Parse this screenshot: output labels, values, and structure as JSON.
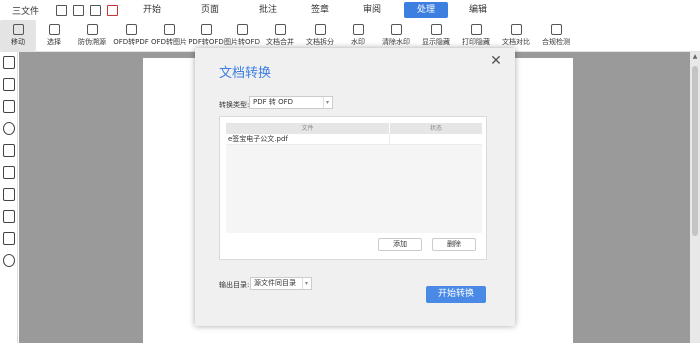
{
  "menubar": {
    "file_label": "三文件",
    "items": [
      "开始",
      "页面",
      "批注",
      "签章",
      "审阅",
      "处理",
      "编辑"
    ],
    "active": "处理"
  },
  "toolbar": {
    "tools": [
      "移动",
      "选择",
      "防伪溯源",
      "OFD转PDF",
      "OFD转图片",
      "PDF转OFD",
      "图片转OFD",
      "文档合并",
      "文档拆分",
      "水印",
      "清除水印",
      "显示隐藏",
      "打印隐藏",
      "文档对比",
      "合规检测"
    ]
  },
  "dialog": {
    "title": "文档转换",
    "close_icon": "close-icon",
    "convert_type_label": "转换类型:",
    "convert_type_value": "PDF 转 OFD",
    "table_headers": [
      "文件",
      "状态"
    ],
    "rows": [
      {
        "file": "e签宝电子公文.pdf",
        "status": ""
      }
    ],
    "add_label": "添加",
    "delete_label": "删除",
    "output_label": "输出目录:",
    "output_value": "源文件同目录",
    "start_label": "开始转换"
  },
  "colors": {
    "accent": "#3d7fe0",
    "workspace": "#9a9a9a"
  }
}
